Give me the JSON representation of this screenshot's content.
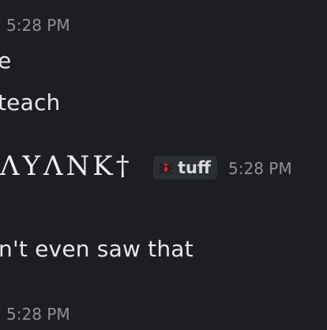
{
  "messages": [
    {
      "timestamp": "5:28 PM"
    },
    {
      "text": "e"
    },
    {
      "text": " teach"
    },
    {
      "username": "ΛYΛNK†",
      "tag": {
        "label": "tuff",
        "icon": "spider-icon"
      },
      "timestamp": "5:28 PM"
    },
    {
      "text": "n't even saw that"
    },
    {
      "timestamp": "5:28 PM"
    }
  ],
  "colors": {
    "background": "#1d1e23",
    "text": "#e6e7ea",
    "timestamp": "#8e9198",
    "tag_background": "#2c2e35"
  }
}
